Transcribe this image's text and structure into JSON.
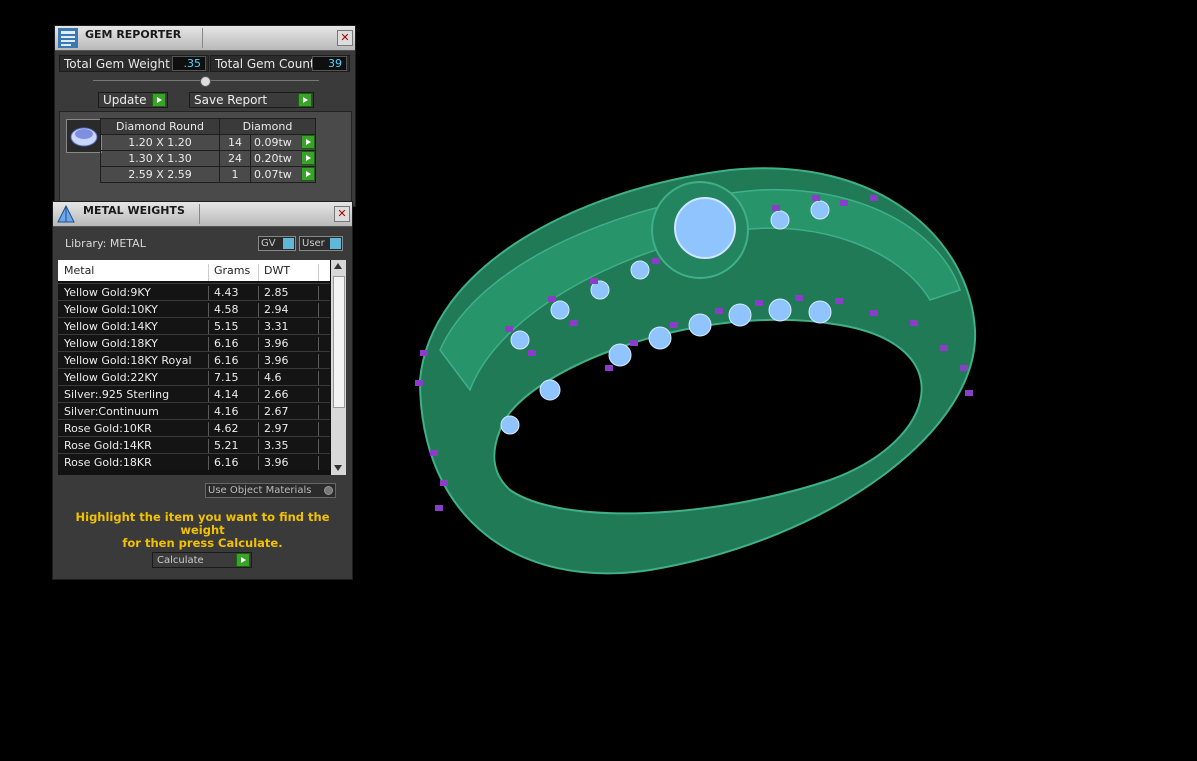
{
  "gem_reporter": {
    "title": "GEM REPORTER",
    "close_label": "✕",
    "total_weight_label": "Total Gem Weight",
    "total_weight_value": ".35",
    "total_count_label": "Total Gem Count",
    "total_count_value": "39",
    "update_label": "Update",
    "save_label": "Save Report",
    "gem_header": {
      "shape": "Diamond Round",
      "material": "Diamond"
    },
    "gems": [
      {
        "size": "1.20 X 1.20",
        "count": "14",
        "weight": "0.09tw"
      },
      {
        "size": "1.30 X 1.30",
        "count": "24",
        "weight": "0.20tw"
      },
      {
        "size": "2.59 X 2.59",
        "count": "1",
        "weight": "0.07tw"
      }
    ]
  },
  "metal_weights": {
    "title": "METAL WEIGHTS",
    "close_label": "✕",
    "library_label": "Library: METAL",
    "gv_label": "GV",
    "user_label": "User",
    "columns": [
      "Metal",
      "Grams",
      "DWT"
    ],
    "rows": [
      {
        "metal": "Yellow Gold:9KY",
        "grams": "4.43",
        "dwt": "2.85"
      },
      {
        "metal": "Yellow Gold:10KY",
        "grams": "4.58",
        "dwt": "2.94"
      },
      {
        "metal": "Yellow Gold:14KY",
        "grams": "5.15",
        "dwt": "3.31"
      },
      {
        "metal": "Yellow Gold:18KY",
        "grams": "6.16",
        "dwt": "3.96"
      },
      {
        "metal": "Yellow Gold:18KY Royal",
        "grams": "6.16",
        "dwt": "3.96"
      },
      {
        "metal": "Yellow Gold:22KY",
        "grams": "7.15",
        "dwt": "4.6"
      },
      {
        "metal": "Silver:.925 Sterling",
        "grams": "4.14",
        "dwt": "2.66"
      },
      {
        "metal": "Silver:Continuum",
        "grams": "4.16",
        "dwt": "2.67"
      },
      {
        "metal": "Rose Gold:10KR",
        "grams": "4.62",
        "dwt": "2.97"
      },
      {
        "metal": "Rose Gold:14KR",
        "grams": "5.21",
        "dwt": "3.35"
      },
      {
        "metal": "Rose Gold:18KR",
        "grams": "6.16",
        "dwt": "3.96"
      }
    ],
    "use_object_materials_label": "Use Object Materials",
    "instruction_line1": "Highlight the item you want to find the weight",
    "instruction_line2": "for then press Calculate.",
    "calculate_label": "Calculate"
  },
  "colors": {
    "ring_body": "#1f7a55",
    "stone": "#8fc4ff",
    "prong": "#8a3ec8",
    "instruction_text": "#f2c200",
    "accent_button": "#3aa12a"
  }
}
